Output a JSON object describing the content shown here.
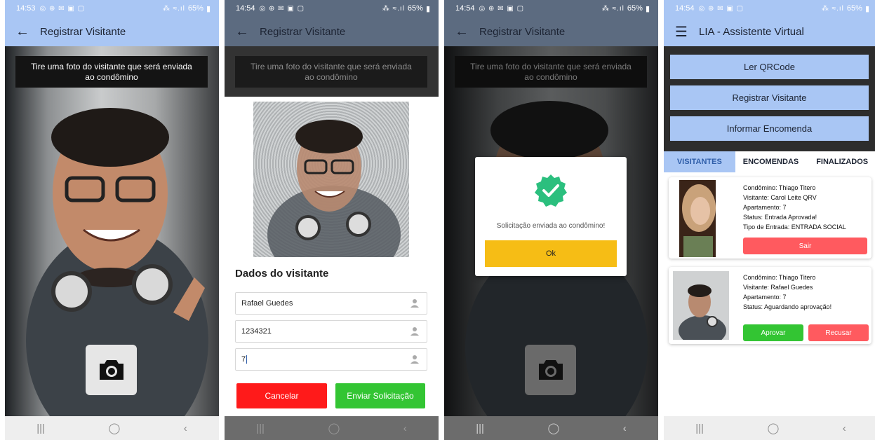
{
  "status": {
    "s1_time": "14:53",
    "time": "14:54",
    "left_icons": "◎ ⊕ ✉ ▣ ▢",
    "right_icons": "⁂ ≈.ıl",
    "battery": "65%"
  },
  "register": {
    "title": "Registrar Visitante",
    "hint": "Tire uma foto do visitante que será enviada ao condômino"
  },
  "form": {
    "section_title": "Dados do visitante",
    "name_value": "Rafael Guedes",
    "doc_value": "1234321",
    "apt_value": "7",
    "cancel_label": "Cancelar",
    "send_label": "Enviar Solicitação"
  },
  "dialog": {
    "message": "Solicitação enviada ao condômino!",
    "ok_label": "Ok"
  },
  "dashboard": {
    "title": "LIA - Assistente Virtual",
    "btn_qr": "Ler QRCode",
    "btn_register": "Registrar Visitante",
    "btn_package": "Informar Encomenda",
    "tabs": [
      "VISITANTES",
      "ENCOMENDAS",
      "FINALIZADOS"
    ],
    "cards": [
      {
        "lines": [
          "Condômino: Thiago Titero",
          "Visitante: Carol Leite QRV",
          "Apartamento: 7",
          "Status: Entrada Aprovada!",
          "Tipo de Entrada: ENTRADA SOCIAL"
        ],
        "exit_label": "Sair"
      },
      {
        "lines": [
          "Condômino: Thiago Titero",
          "Visitante: Rafael Guedes",
          "Apartamento: 7",
          "Status: Aguardando aprovação!"
        ],
        "approve_label": "Aprovar",
        "reject_label": "Recusar"
      }
    ]
  },
  "nav": {
    "recent": "|||",
    "home": "◯",
    "back": "‹"
  },
  "colors": {
    "appbar": "#a9c6f4",
    "cancel": "#ff1a1a",
    "send": "#33c533",
    "ok": "#f6bd15",
    "exit": "#ff5a5f",
    "approve": "#33c533",
    "reject": "#ff5a5f",
    "success": "#2bbf7e"
  }
}
